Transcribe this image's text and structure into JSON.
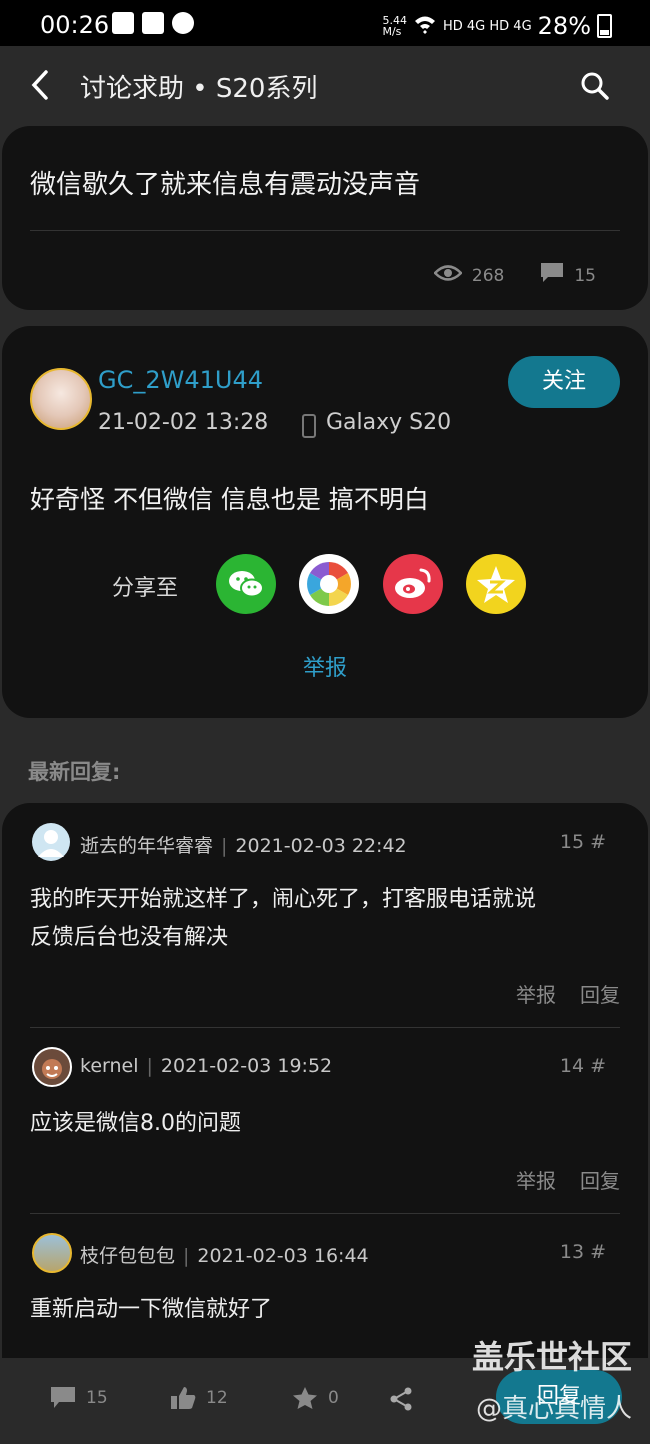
{
  "status_bar": {
    "time": "00:26",
    "speed": "5.44\nM/s",
    "network": "HD 4G HD 4G",
    "battery": "28%"
  },
  "header": {
    "title": "讨论求助 • S20系列"
  },
  "post": {
    "title": "微信歇久了就来信息有震动没声音",
    "views": "268",
    "comments": "15"
  },
  "author": {
    "name": "GC_2W41U44",
    "date": "21-02-02 13:28",
    "device": "Galaxy S20",
    "follow_label": "关注",
    "body": "好奇怪 不但微信 信息也是 搞不明白",
    "share_label": "分享至",
    "report_label": "举报"
  },
  "replies_heading": "最新回复:",
  "replies": [
    {
      "user": "逝去的年华睿睿",
      "time": "2021-02-03 22:42",
      "floor": "15 #",
      "text_line1": "我的昨天开始就这样了，闹心死了，打客服电话就说",
      "text_line2": "反馈后台也没有解决",
      "report": "举报",
      "reply": "回复"
    },
    {
      "user": "kernel",
      "time": "2021-02-03 19:52",
      "floor": "14 #",
      "text_line1": "应该是微信8.0的问题",
      "report": "举报",
      "reply": "回复"
    },
    {
      "user": "枝仔包包包",
      "time": "2021-02-03 16:44",
      "floor": "13 #",
      "text_line1": "重新启动一下微信就好了"
    }
  ],
  "bottom_bar": {
    "comments": "15",
    "likes": "12",
    "stars": "0",
    "reply_label": "回复"
  },
  "watermark": {
    "line1": "盖乐世社区",
    "line2": "@真心真情人"
  },
  "colors": {
    "accent": "#13788f",
    "link": "#2f9ec9",
    "card": "#121212",
    "background": "#2a2a2a"
  }
}
